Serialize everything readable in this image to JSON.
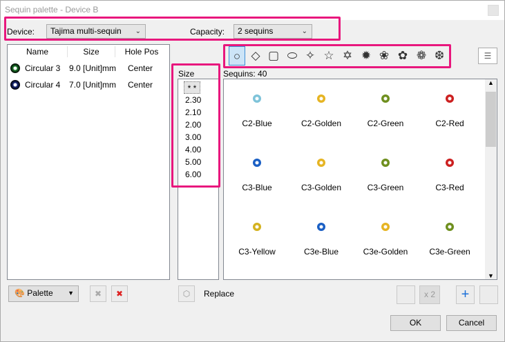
{
  "window": {
    "title": "Sequin palette - Device B"
  },
  "device": {
    "label": "Device:",
    "value": "Tajima multi-sequin"
  },
  "capacity": {
    "label": "Capacity:",
    "value": "2 sequins"
  },
  "palette_table": {
    "headers": [
      "Name",
      "Size",
      "Hole Pos"
    ],
    "rows": [
      {
        "name": "Circular 3",
        "size": "9.0 [Unit]mm",
        "hole": "Center"
      },
      {
        "name": "Circular 4",
        "size": "7.0 [Unit]mm",
        "hole": "Center"
      }
    ]
  },
  "size_list": {
    "header": "Size",
    "items": [
      "* *",
      "2.30",
      "2.10",
      "2.00",
      "3.00",
      "4.00",
      "5.00",
      "6.00"
    ]
  },
  "sequins": {
    "label": "Sequins: 40",
    "items": [
      {
        "name": "C2-Blue",
        "color": "#7ec3d9"
      },
      {
        "name": "C2-Golden",
        "color": "#e6b422"
      },
      {
        "name": "C2-Green",
        "color": "#6e8f1e"
      },
      {
        "name": "C2-Red",
        "color": "#cc1f1f"
      },
      {
        "name": "C3-Blue",
        "color": "#1a5fc4"
      },
      {
        "name": "C3-Golden",
        "color": "#e6b422"
      },
      {
        "name": "C3-Green",
        "color": "#6e8f1e"
      },
      {
        "name": "C3-Red",
        "color": "#cc1f1f"
      },
      {
        "name": "C3-Yellow",
        "color": "#d4b21f"
      },
      {
        "name": "C3e-Blue",
        "color": "#1a5fc4"
      },
      {
        "name": "C3e-Golden",
        "color": "#e6b422"
      },
      {
        "name": "C3e-Green",
        "color": "#6e8f1e"
      }
    ]
  },
  "shapes": [
    "circle",
    "diamond",
    "square",
    "ellipse",
    "star4",
    "star5",
    "star6",
    "star8",
    "flower",
    "flower2",
    "flower3",
    "daisy"
  ],
  "buttons": {
    "palette": "Palette",
    "replace": "Replace",
    "x2": "x 2",
    "ok": "OK",
    "cancel": "Cancel"
  }
}
